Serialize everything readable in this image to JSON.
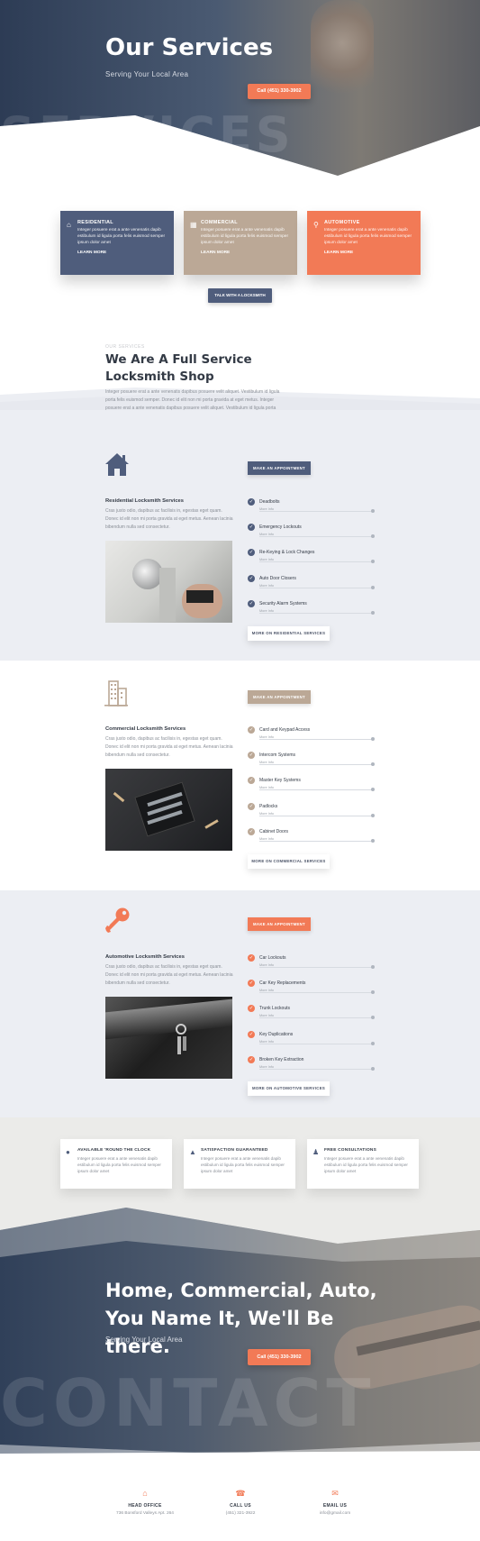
{
  "hero": {
    "title": "Our Services",
    "subtitle": "Serving Your Local Area",
    "cta": "Call (451) 330-3902",
    "watermark": "SERVICES"
  },
  "cards": [
    {
      "title": "RESIDENTIAL",
      "icon": "house-icon",
      "color": "#4f5d7c",
      "desc": "Integer posuere erat a ante venenatis dapib estibulum id ligula porta felis euismod semper ipsum dolor amet",
      "link": "LEARN MORE"
    },
    {
      "title": "COMMERCIAL",
      "icon": "building-icon",
      "color": "#bba896",
      "desc": "Integer posuere erat a ante venenatis dapib estibulum id ligula porta felis euismod semper ipsum dolor amet",
      "link": "LEARN MORE"
    },
    {
      "title": "AUTOMOTIVE",
      "icon": "key-icon",
      "color": "#f27a56",
      "desc": "Integer posuere erat a ante venenatis dapib estibulum id ligula porta felis euismod semper ipsum dolor amet",
      "link": "LEARN MORE"
    }
  ],
  "talk_button": "TALK WITH A LOCKSMITH",
  "intro": {
    "overline": "OUR SERVICES",
    "title": "We Are A Full Service Locksmith Shop",
    "body": "Integer posuere erat a ante venenatis dapibus posuere velit aliquet. Vestibulum id ligula porta felis euismod semper. Donec id elit non mi porta gravida at eget metus. Integer posuere erat a ante venenatis dapibus posuere velit aliquet. Vestibulum id ligula porta felis euismod semper. Donec id elit non mi porta gravida at eget"
  },
  "sections": [
    {
      "key": "residential",
      "title": "Residential Locksmith Services",
      "accent": "#4f5d7c",
      "icon": "house-icon",
      "body": "Cras justo odio, dapibus ac facilisis in, egestas eget quam. Donec id elit non mi porta gravida at eget metus. Aenean lacinia bibendum nulla sed consectetur.",
      "appointment": "MAKE AN APPOINTMENT",
      "items": [
        "Deadbolts",
        "Emergency Lockouts",
        "Re-Keying & Lock Changes",
        "Auto Door Closers",
        "Security Alarm Systems"
      ],
      "more_info": "More Info",
      "more_button": "MORE ON RESIDENTIAL SERVICES"
    },
    {
      "key": "commercial",
      "title": "Commercial Locksmith Services",
      "accent": "#bba896",
      "icon": "building-icon",
      "body": "Cras justo odio, dapibus ac facilisis in, egestas eget quam. Donec id elit non mi porta gravida at eget metus. Aenean lacinia bibendum nulla sed consectetur.",
      "appointment": "MAKE AN APPOINTMENT",
      "items": [
        "Card and Keypad Access",
        "Intercom Systems",
        "Master Key Systems",
        "Padlocks",
        "Cabinet Doors"
      ],
      "more_info": "More Info",
      "more_button": "MORE ON COMMERCIAL SERVICES"
    },
    {
      "key": "automotive",
      "title": "Automotive Locksmith Services",
      "accent": "#f27a56",
      "icon": "key-icon",
      "body": "Cras justo odio, dapibus ac facilisis in, egestas eget quam. Donec id elit non mi porta gravida at eget metus. Aenean lacinia bibendum nulla sed consectetur.",
      "appointment": "MAKE AN APPOINTMENT",
      "items": [
        "Car Lockouts",
        "Car Key Replacements",
        "Trunk Lockouts",
        "Key Duplications",
        "Broken Key Extraction"
      ],
      "more_info": "More Info",
      "more_button": "MORE ON AUTOMOTIVE SERVICES"
    }
  ],
  "features": [
    {
      "title": "AVAILABLE 'ROUND THE CLOCK",
      "icon": "clock-icon",
      "desc": "Integer posuere erat a ante venenatis dapib estibulum id ligula porta felis euismod semper ipsum dolor amet"
    },
    {
      "title": "SATISFACTION GUARANTEED",
      "icon": "thumbs-up-icon",
      "desc": "Integer posuere erat a ante venenatis dapib estibulum id ligula porta felis euismod semper ipsum dolor amet"
    },
    {
      "title": "FREE CONSULTATIONS",
      "icon": "users-icon",
      "desc": "Integer posuere erat a ante venenatis dapib estibulum id ligula porta felis euismod semper ipsum dolor amet"
    }
  ],
  "contact": {
    "title_line1": "Home, Commercial, Auto,",
    "title_line2": "You Name It, We'll Be there.",
    "subtitle": "Serving Your Local Area",
    "cta": "Call (451) 330-3902",
    "watermark": "CONTACT"
  },
  "footer": [
    {
      "title": "HEAD OFFICE",
      "value": "736 Bonsford Valleys Apt. 264",
      "icon": "home-icon"
    },
    {
      "title": "CALL US",
      "value": "(451) 321-3922",
      "icon": "phone-icon"
    },
    {
      "title": "EMAIL US",
      "value": "info@gmail.com",
      "icon": "envelope-icon"
    }
  ]
}
